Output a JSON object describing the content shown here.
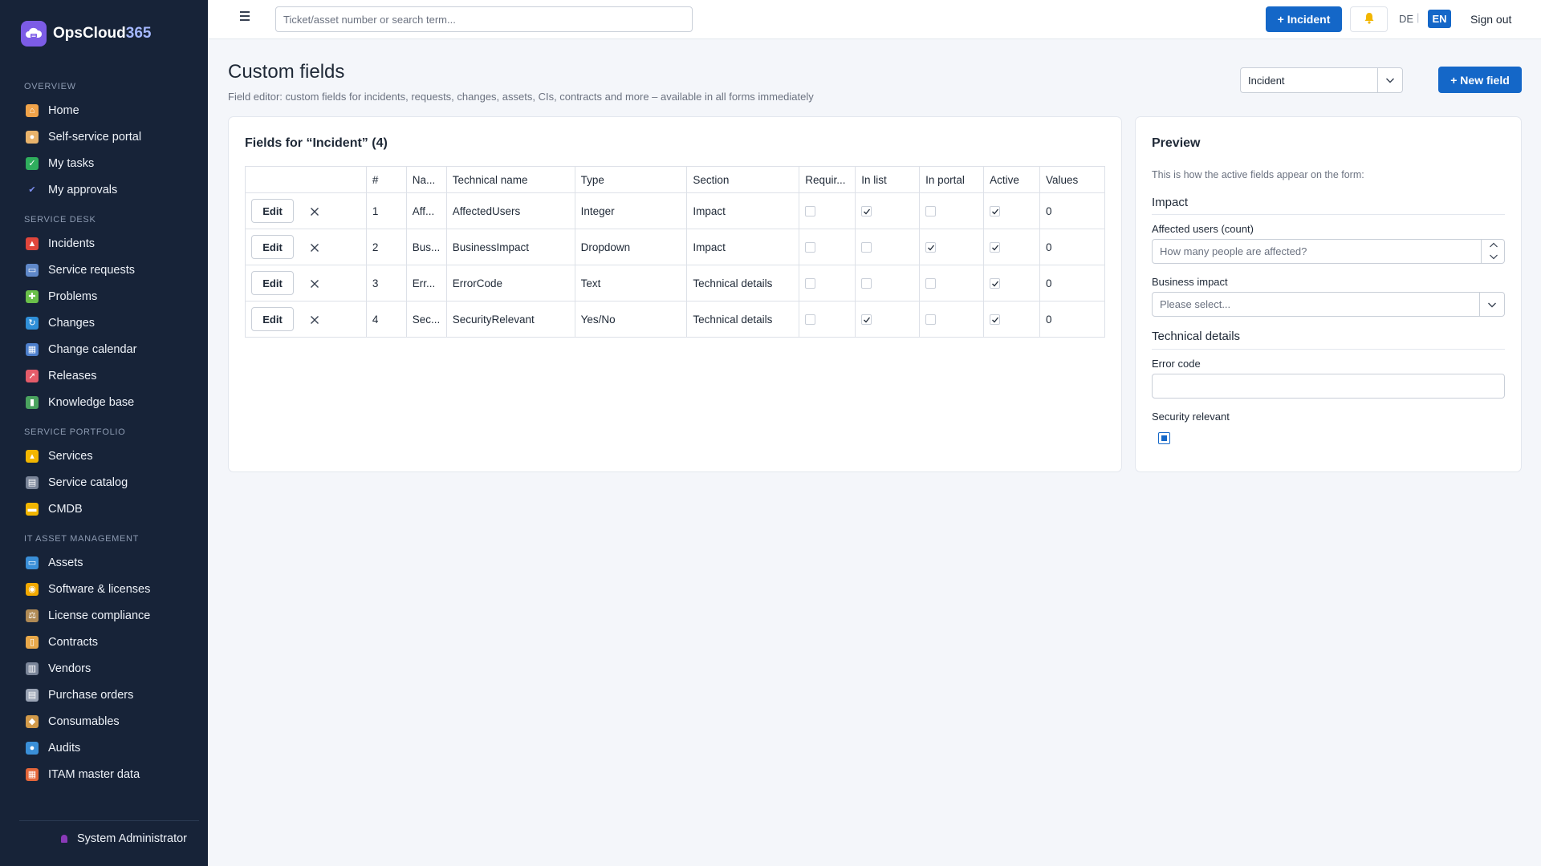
{
  "app": {
    "brand_main": "OpsCloud",
    "brand_accent": "365",
    "user_name": "System Administrator"
  },
  "sidebar": {
    "sections": [
      {
        "title": "OVERVIEW",
        "items": [
          {
            "label": "Home",
            "icon": "home-icon"
          },
          {
            "label": "Self-service portal",
            "icon": "person-icon"
          },
          {
            "label": "My tasks",
            "icon": "checkbox-icon"
          },
          {
            "label": "My approvals",
            "icon": "checkmark-icon"
          }
        ]
      },
      {
        "title": "SERVICE DESK",
        "items": [
          {
            "label": "Incidents",
            "icon": "siren-icon"
          },
          {
            "label": "Service requests",
            "icon": "inbox-icon"
          },
          {
            "label": "Problems",
            "icon": "puzzle-icon"
          },
          {
            "label": "Changes",
            "icon": "cycle-icon"
          },
          {
            "label": "Change calendar",
            "icon": "calendar-icon"
          },
          {
            "label": "Releases",
            "icon": "rocket-icon"
          },
          {
            "label": "Knowledge base",
            "icon": "books-icon"
          }
        ]
      },
      {
        "title": "SERVICE PORTFOLIO",
        "items": [
          {
            "label": "Services",
            "icon": "bell-service-icon"
          },
          {
            "label": "Service catalog",
            "icon": "catalog-icon"
          },
          {
            "label": "CMDB",
            "icon": "folder-icon"
          }
        ]
      },
      {
        "title": "IT ASSET MANAGEMENT",
        "items": [
          {
            "label": "Assets",
            "icon": "computer-icon"
          },
          {
            "label": "Software & licenses",
            "icon": "disc-icon"
          },
          {
            "label": "License compliance",
            "icon": "scale-icon"
          },
          {
            "label": "Contracts",
            "icon": "document-icon"
          },
          {
            "label": "Vendors",
            "icon": "building-icon"
          },
          {
            "label": "Purchase orders",
            "icon": "receipt-icon"
          },
          {
            "label": "Consumables",
            "icon": "package-icon"
          },
          {
            "label": "Audits",
            "icon": "magnifier-icon"
          },
          {
            "label": "ITAM master data",
            "icon": "bricks-icon"
          }
        ]
      }
    ]
  },
  "topbar": {
    "search_placeholder": "Ticket/asset number or search term...",
    "incident_button": "+ Incident",
    "lang_de": "DE",
    "lang_sep": "|",
    "lang_en": "EN",
    "signout": "Sign out"
  },
  "page": {
    "title": "Custom fields",
    "subtitle": "Field editor: custom fields for incidents, requests, changes, assets, CIs, contracts and more – available in all forms immediately",
    "entity_select": "Incident",
    "new_field_button": "+ New field"
  },
  "fields_table": {
    "title": "Fields for “Incident” (4)",
    "headers": [
      "",
      "#",
      "Na...",
      "Technical name",
      "Type",
      "Section",
      "Requir...",
      "In list",
      "In portal",
      "Active",
      "Values"
    ],
    "edit_label": "Edit",
    "rows": [
      {
        "num": "1",
        "name": "Aff...",
        "technical": "AffectedUsers",
        "type": "Integer",
        "section": "Impact",
        "required": false,
        "in_list": true,
        "in_portal": false,
        "active": true,
        "values": "0"
      },
      {
        "num": "2",
        "name": "Bus...",
        "technical": "BusinessImpact",
        "type": "Dropdown",
        "section": "Impact",
        "required": false,
        "in_list": false,
        "in_portal": true,
        "active": true,
        "values": "0"
      },
      {
        "num": "3",
        "name": "Err...",
        "technical": "ErrorCode",
        "type": "Text",
        "section": "Technical details",
        "required": false,
        "in_list": false,
        "in_portal": false,
        "active": true,
        "values": "0"
      },
      {
        "num": "4",
        "name": "Sec...",
        "technical": "SecurityRelevant",
        "type": "Yes/No",
        "section": "Technical details",
        "required": false,
        "in_list": true,
        "in_portal": false,
        "active": true,
        "values": "0"
      }
    ]
  },
  "preview": {
    "title": "Preview",
    "description": "This is how the active fields appear on the form:",
    "section_impact": "Impact",
    "affected_label": "Affected users (count)",
    "affected_placeholder": "How many people are affected?",
    "business_label": "Business impact",
    "business_placeholder": "Please select...",
    "section_technical": "Technical details",
    "error_label": "Error code",
    "error_value": "",
    "security_label": "Security relevant",
    "security_checked": true
  },
  "colors": {
    "primary": "#1467c8",
    "sidebar_bg": "#172338",
    "brand_accent": "#a5b8ff"
  }
}
